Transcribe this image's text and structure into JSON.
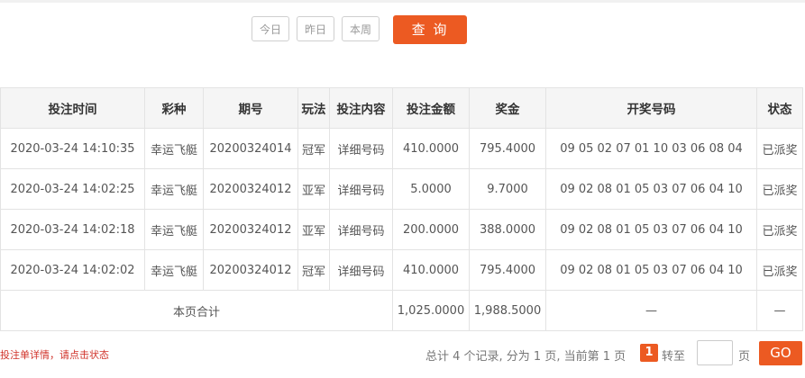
{
  "filters": {
    "today": "今日",
    "yesterday": "昨日",
    "this_week": "本周",
    "query": "查 询"
  },
  "table": {
    "headers": [
      "投注时间",
      "彩种",
      "期号",
      "玩法",
      "投注内容",
      "投注金额",
      "奖金",
      "开奖号码",
      "状态"
    ],
    "rows": [
      {
        "time": "2020-03-24 14:10:35",
        "lottery": "幸运飞艇",
        "issue": "20200324014",
        "play": "冠军",
        "content": "详细号码",
        "amount": "410.0000",
        "prize": "795.4000",
        "numbers": "09 05 02 07 01 10 03 06 08 04",
        "status": "已派奖"
      },
      {
        "time": "2020-03-24 14:02:25",
        "lottery": "幸运飞艇",
        "issue": "20200324012",
        "play": "亚军",
        "content": "详细号码",
        "amount": "5.0000",
        "prize": "9.7000",
        "numbers": "09 02 08 01 05 03 07 06 04 10",
        "status": "已派奖"
      },
      {
        "time": "2020-03-24 14:02:18",
        "lottery": "幸运飞艇",
        "issue": "20200324012",
        "play": "亚军",
        "content": "详细号码",
        "amount": "200.0000",
        "prize": "388.0000",
        "numbers": "09 02 08 01 05 03 07 06 04 10",
        "status": "已派奖"
      },
      {
        "time": "2020-03-24 14:02:02",
        "lottery": "幸运飞艇",
        "issue": "20200324012",
        "play": "冠军",
        "content": "详细号码",
        "amount": "410.0000",
        "prize": "795.4000",
        "numbers": "09 02 08 01 05 03 07 06 04 10",
        "status": "已派奖"
      }
    ],
    "summary": {
      "label": "本页合计",
      "amount": "1,025.0000",
      "prize": "1,988.5000",
      "numbers": "—",
      "status": "—"
    }
  },
  "footer": {
    "note": "投注单详情，请点击状态",
    "pager_info": "总计 4 个记录, 分为 1 页, 当前第 1 页",
    "current_page": "1",
    "goto_label": "转至",
    "page_unit": "页",
    "go": "GO"
  },
  "colors": {
    "accent": "#ec5a22",
    "link_green": "#2b8a1e",
    "status_orange": "#e2612a"
  }
}
